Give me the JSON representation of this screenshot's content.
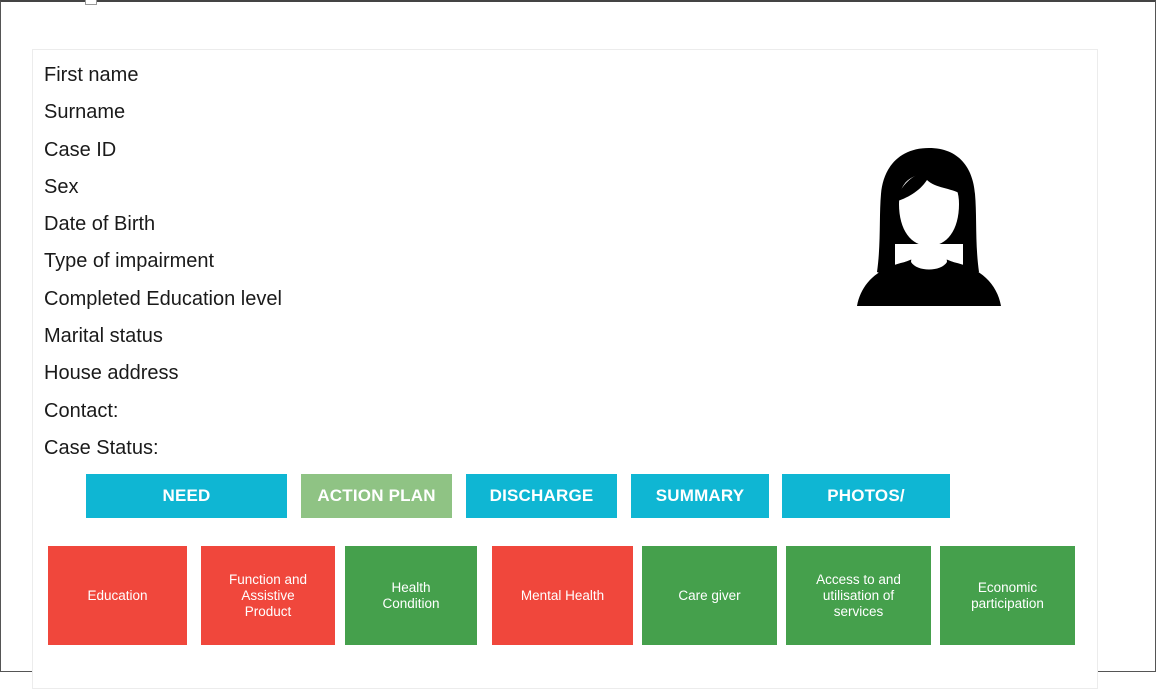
{
  "profile_fields": [
    "First name",
    "Surname",
    "Case ID",
    "Sex",
    "Date of Birth",
    "Type of impairment",
    "Completed Education level",
    "Marital status",
    "House address",
    "Contact:",
    "Case Status:"
  ],
  "avatar_icon": "female-user-icon",
  "tabs": [
    {
      "label": "NEED",
      "color": "#0fb6d3"
    },
    {
      "label": "ACTION PLAN",
      "color": "#8fc384"
    },
    {
      "label": "DISCHARGE",
      "color": "#0fb6d3"
    },
    {
      "label": "SUMMARY",
      "color": "#0fb6d3"
    },
    {
      "label": "PHOTOS/",
      "color": "#0fb6d3"
    }
  ],
  "domains": [
    {
      "label": "Education",
      "color": "#f0473c"
    },
    {
      "label": "Function and\nAssistive\nProduct",
      "color": "#f0473c"
    },
    {
      "label": "Health\nCondition",
      "color": "#45a04c"
    },
    {
      "label": "Mental Health",
      "color": "#f0473c"
    },
    {
      "label": "Care giver",
      "color": "#45a04c"
    },
    {
      "label": "Access to and\nutilisation of\nservices",
      "color": "#45a04c"
    },
    {
      "label": "Economic\nparticipation",
      "color": "#45a04c"
    }
  ]
}
